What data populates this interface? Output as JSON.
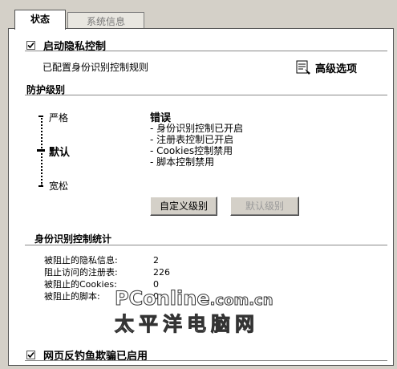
{
  "tabs": [
    {
      "label": "状态",
      "active": true
    },
    {
      "label": "系统信息",
      "active": false
    }
  ],
  "privacy_control": {
    "checked": true,
    "label": "启动隐私控制",
    "status_text": "已配置身份识别控制规则",
    "advanced_button": "高级选项",
    "advanced_icon": "settings-sheet-icon"
  },
  "protection": {
    "title": "防护级别",
    "levels": [
      "严格",
      "默认",
      "宽松"
    ],
    "current_level": "默认",
    "heading": "错误",
    "details": [
      "- 身份识别控制已开启",
      "- 注册表控制已开启",
      "- Cookies控制禁用",
      "- 脚本控制禁用"
    ],
    "custom_button": "自定义级别",
    "default_button": "默认级别"
  },
  "stats": {
    "title": "身份识别控制统计",
    "rows": [
      {
        "label": "被阻止的隐私信息:",
        "value": "2"
      },
      {
        "label": "阻止访问的注册表:",
        "value": "226"
      },
      {
        "label": "被阻止的Cookies:",
        "value": "0"
      },
      {
        "label": "被阻止的脚本:",
        "value": "0"
      }
    ]
  },
  "watermark": {
    "line1_main": "PConline",
    "line1_tail": ".com.cn",
    "line2": "太平洋电脑网"
  },
  "phishing": {
    "checked": true,
    "label": "网页反钓鱼欺骗已启用"
  }
}
